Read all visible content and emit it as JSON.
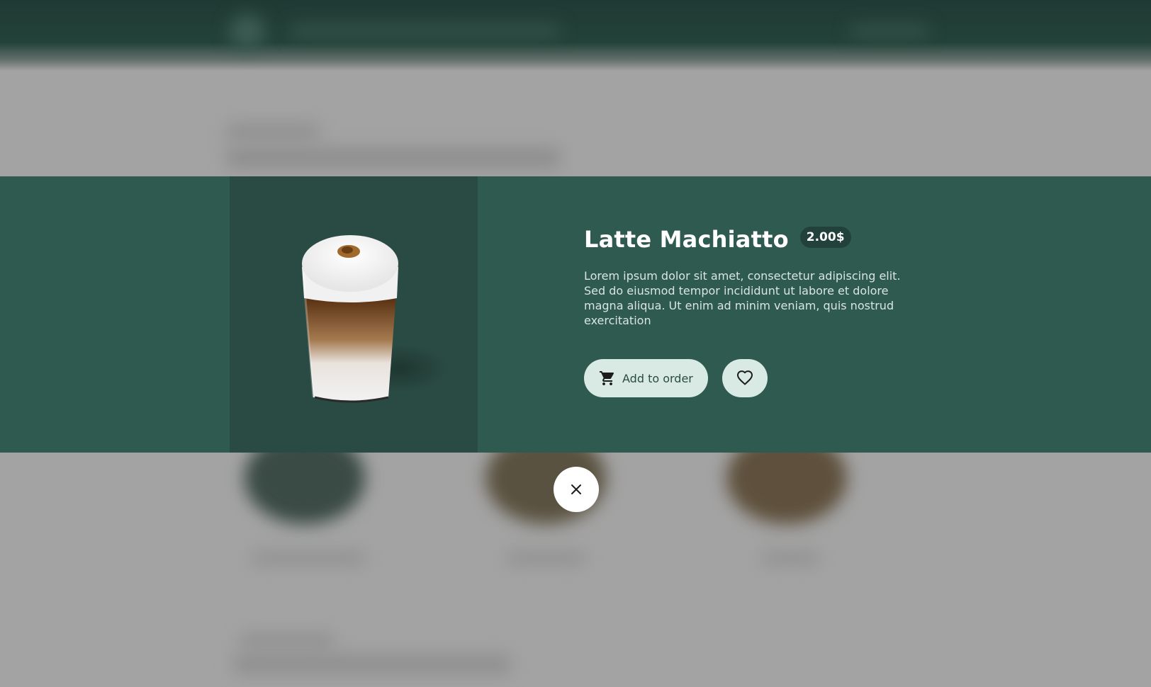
{
  "product": {
    "name": "Latte Machiatto",
    "price": "2.00$",
    "description": "Lorem ipsum dolor sit amet, consectetur adipiscing elit. Sed do eiusmod tempor incididunt ut labore et dolore magna aliqua. Ut enim ad minim veniam, quis nostrud exercitation",
    "image_icon": "latte-macchiato-cup"
  },
  "actions": {
    "add_to_order_label": "Add to order",
    "add_to_order_icon": "cart-icon",
    "favorite_icon": "heart-icon",
    "close_icon": "close-icon"
  },
  "colors": {
    "modal_background": "#2f5a50",
    "image_panel_background": "#2a4b43",
    "button_background": "#d8eae3",
    "overlay_background": "#a3a3a3",
    "header_background": "#1f3a33"
  }
}
